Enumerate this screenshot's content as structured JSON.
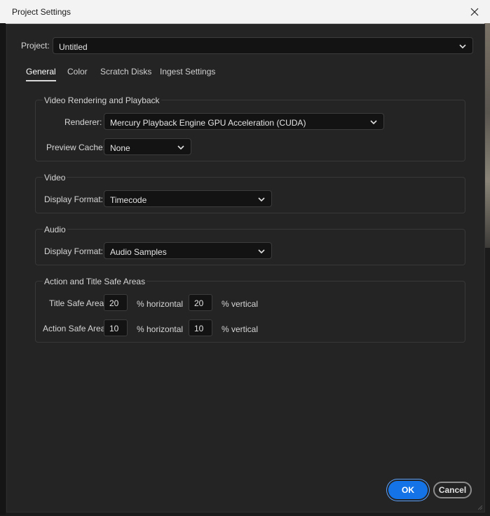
{
  "window": {
    "title": "Project Settings",
    "close_icon": "close-icon"
  },
  "project": {
    "label": "Project:",
    "value": "Untitled"
  },
  "tabs": [
    {
      "label": "General",
      "active": true
    },
    {
      "label": "Color",
      "active": false
    },
    {
      "label": "Scratch Disks",
      "active": false
    },
    {
      "label": "Ingest Settings",
      "active": false
    }
  ],
  "video_rendering": {
    "title": "Video Rendering and Playback",
    "renderer_label": "Renderer:",
    "renderer_value": "Mercury Playback Engine GPU Acceleration (CUDA)",
    "preview_cache_label": "Preview Cache:",
    "preview_cache_value": "None"
  },
  "video": {
    "title": "Video",
    "display_format_label": "Display Format:",
    "display_format_value": "Timecode"
  },
  "audio": {
    "title": "Audio",
    "display_format_label": "Display Format:",
    "display_format_value": "Audio Samples"
  },
  "safe_areas": {
    "title": "Action and Title Safe Areas",
    "title_safe": {
      "label": "Title Safe Area",
      "horizontal": "20",
      "horizontal_label": "% horizontal",
      "vertical": "20",
      "vertical_label": "% vertical"
    },
    "action_safe": {
      "label": "Action Safe Area",
      "horizontal": "10",
      "horizontal_label": "% horizontal",
      "vertical": "10",
      "vertical_label": "% vertical"
    }
  },
  "buttons": {
    "ok": "OK",
    "cancel": "Cancel"
  },
  "colors": {
    "accent": "#1473e6",
    "panel": "#242424",
    "field": "#131313"
  }
}
